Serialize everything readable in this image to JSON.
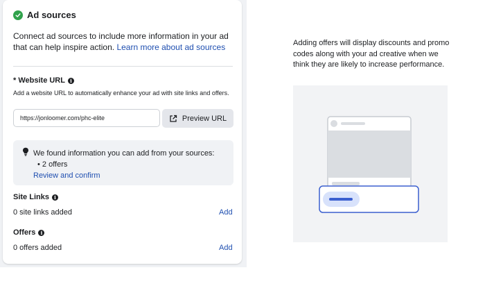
{
  "panel": {
    "title": "Ad sources",
    "intro_text": "Connect ad sources to include more information in your ad that can help inspire action.",
    "learn_more_link": "Learn more about ad sources"
  },
  "website": {
    "label": "* Website URL",
    "help_text": "Add a website URL to automatically enhance your ad with site links and offers.",
    "url_value": "https://jonloomer.com/phc-elite",
    "preview_button": "Preview URL"
  },
  "notice": {
    "text": "We found information you can add from your sources:",
    "offers": "• 2 offers",
    "review_link": "Review and confirm"
  },
  "site_links": {
    "label": "Site Links",
    "status": "0 site links added",
    "add_label": "Add"
  },
  "offers": {
    "label": "Offers",
    "status": "0 offers added",
    "add_label": "Add"
  },
  "right_panel": {
    "description": "Adding offers will display discounts and promo codes along with your ad creative when we think they are likely to increase performance."
  },
  "colors": {
    "accent_link": "#1f4fb0",
    "success_green": "#31a24c",
    "illustration_blue": "#3b5fcf"
  }
}
